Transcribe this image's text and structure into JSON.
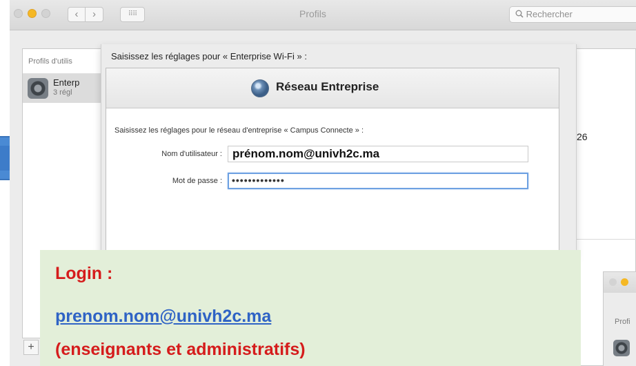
{
  "window": {
    "title": "Profils",
    "nav_back": "‹",
    "nav_forward": "›",
    "grid_glyph": "⠿⠿",
    "search_placeholder": "Rechercher"
  },
  "profiles_pane": {
    "header": "Profils d'utilis",
    "item_name": "Enterp",
    "item_subtitle": "3 régl",
    "add_label": "+"
  },
  "detail_pane": {
    "partial_text": "26"
  },
  "sheet": {
    "prompt": "Saisissez les réglages pour « Enterprise Wi-Fi » :",
    "network_title": "Réseau Entreprise",
    "network_prompt": "Saisissez les réglages pour le réseau d'entreprise « Campus Connecte » :",
    "username_label": "Nom d'utilisateur :",
    "username_value": "prénom.nom@univh2c.ma",
    "password_label": "Mot de passe :",
    "password_value": "•••••••••••••"
  },
  "second_window": {
    "label": "Profi"
  },
  "annotation": {
    "title": "Login :",
    "link": "prenom.nom@univh2c.ma",
    "subtitle": "(enseignants et administratifs)"
  },
  "colors": {
    "annotation_bg": "#e3efd9",
    "annotation_red": "#d51c1c",
    "annotation_link": "#2f63c5",
    "focus_ring": "#6ea1e2",
    "arrow_blue": "#4a8ad4"
  }
}
